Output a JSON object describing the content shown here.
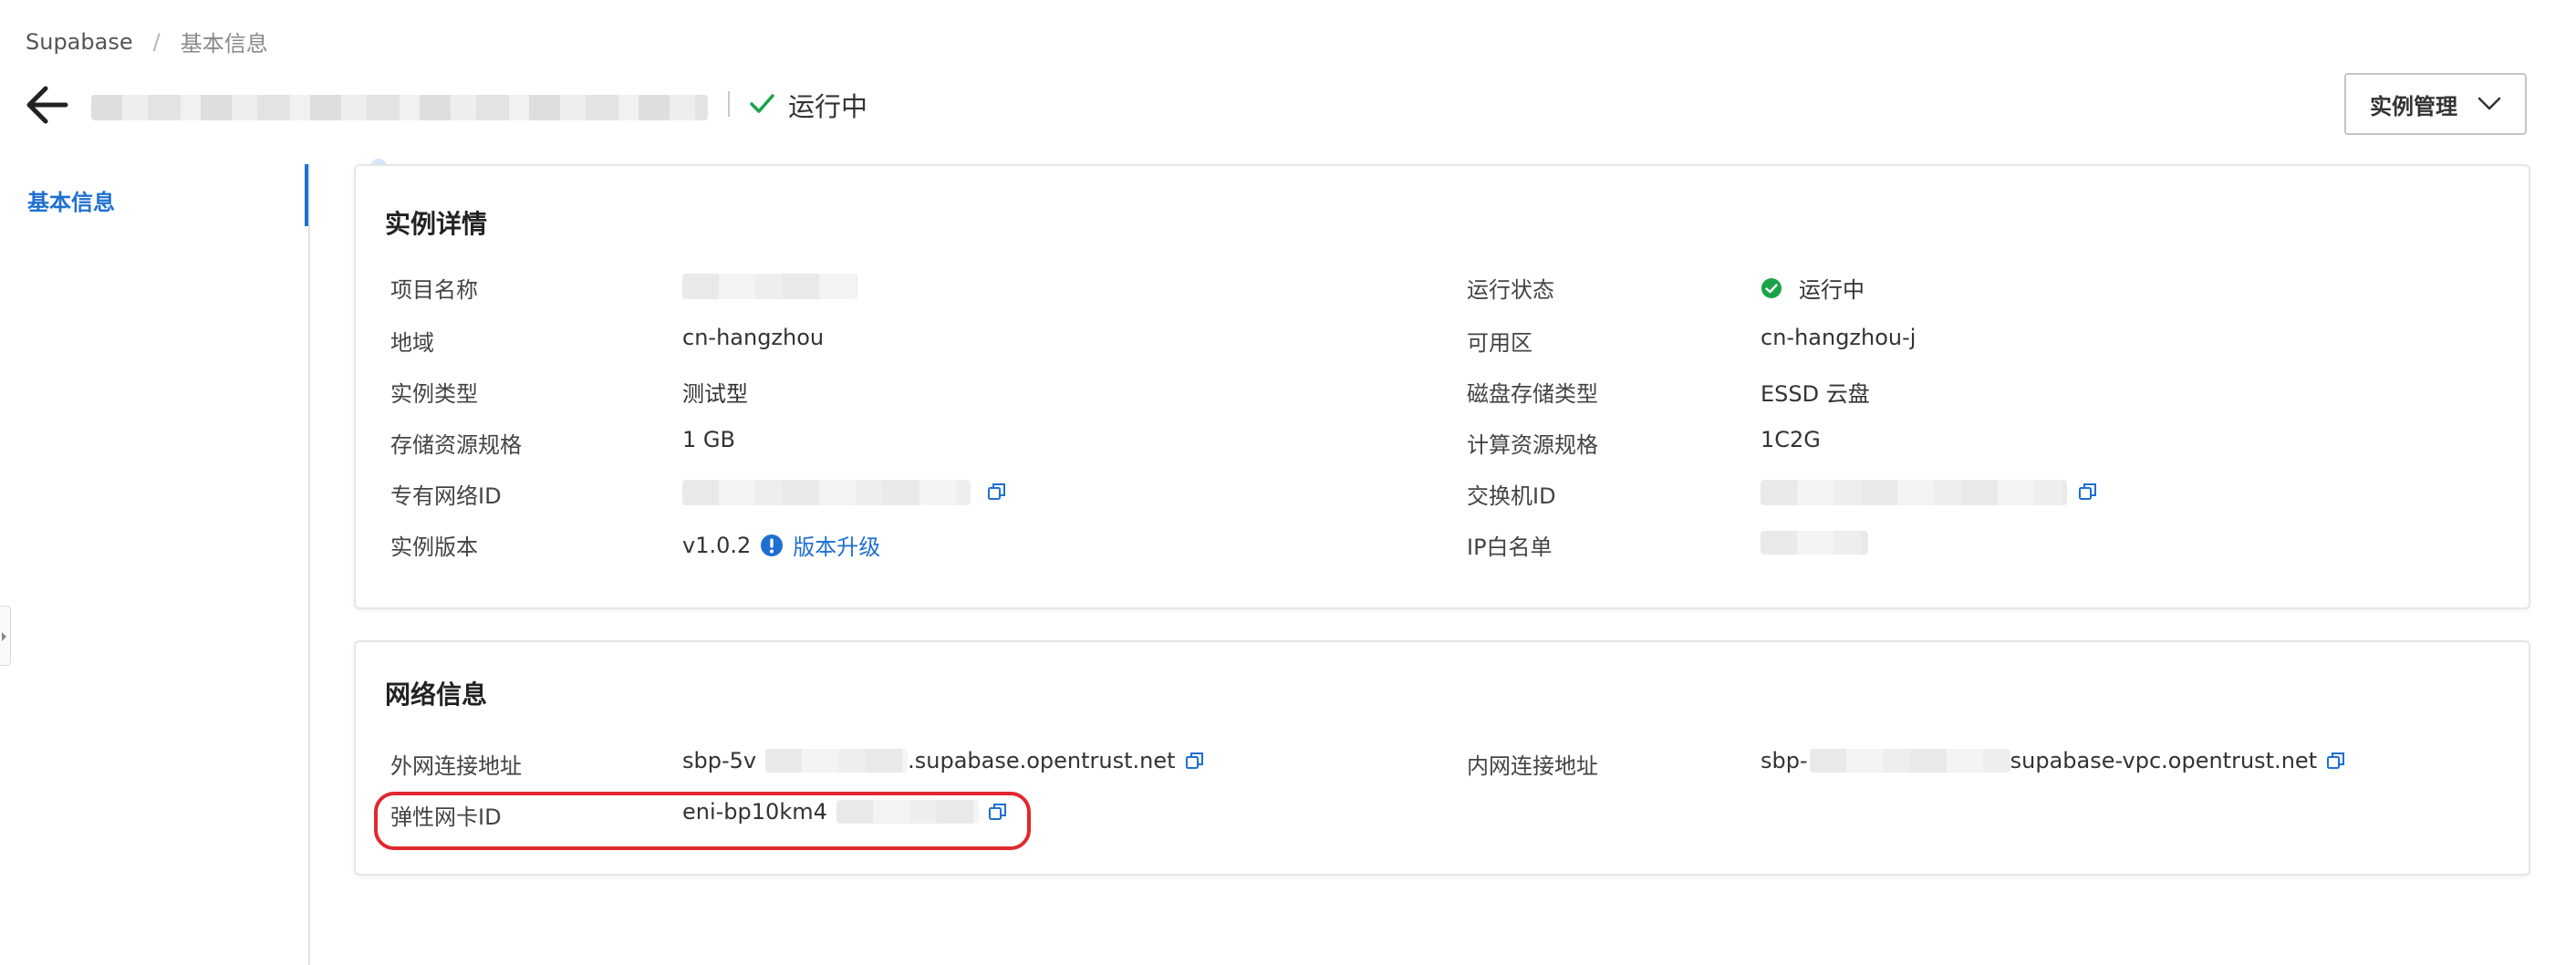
{
  "breadcrumb": {
    "root": "Supabase",
    "separator": "/",
    "current": "基本信息"
  },
  "header": {
    "status": "运行中",
    "manage_button": "实例管理"
  },
  "sidebar": {
    "items": [
      {
        "label": "基本信息",
        "active": true
      }
    ]
  },
  "instance_details": {
    "title": "实例详情",
    "left": [
      {
        "label": "项目名称",
        "value": ""
      },
      {
        "label": "地域",
        "value": "cn-hangzhou"
      },
      {
        "label": "实例类型",
        "value": "测试型"
      },
      {
        "label": "存储资源规格",
        "value": "1 GB"
      },
      {
        "label": "专有网络ID",
        "value": ""
      },
      {
        "label": "实例版本",
        "value": "v1.0.2",
        "link": "版本升级"
      }
    ],
    "right": [
      {
        "label": "运行状态",
        "value": "运行中"
      },
      {
        "label": "可用区",
        "value": "cn-hangzhou-j"
      },
      {
        "label": "磁盘存储类型",
        "value": "ESSD 云盘"
      },
      {
        "label": "计算资源规格",
        "value": "1C2G"
      },
      {
        "label": "交换机ID",
        "value": ""
      },
      {
        "label": "IP白名单",
        "value": ""
      }
    ]
  },
  "network_info": {
    "title": "网络信息",
    "public_endpoint": {
      "label": "外网连接地址",
      "value_prefix": "sbp-5v",
      "value_suffix": ".supabase.opentrust.net"
    },
    "private_endpoint": {
      "label": "内网连接地址",
      "value_prefix": "sbp-",
      "value_suffix": "supabase-vpc.opentrust.net"
    },
    "eni": {
      "label": "弹性网卡ID",
      "value_prefix": "eni-bp10km4"
    }
  },
  "colors": {
    "accent": "#1f6fd1",
    "success": "#1aa34a",
    "highlight": "#e0282e",
    "border": "#e6e6e6"
  },
  "icons": [
    "back-arrow-icon",
    "check-icon",
    "chevron-down-icon",
    "copy-icon",
    "info-icon",
    "success-dot-icon"
  ]
}
